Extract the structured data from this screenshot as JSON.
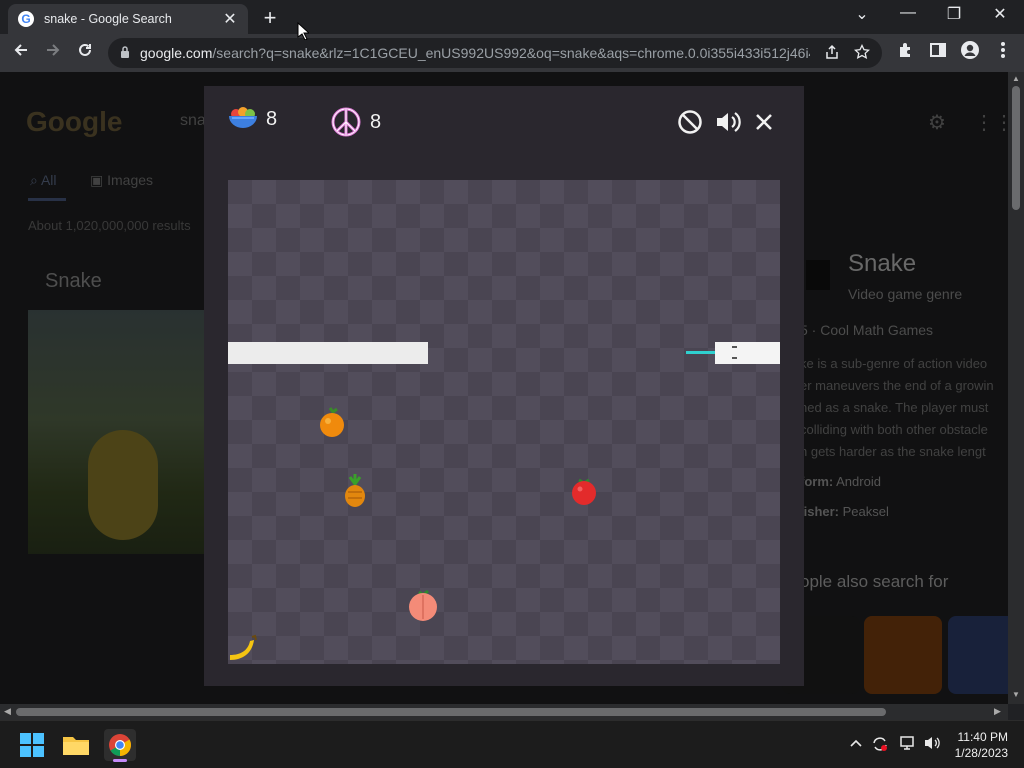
{
  "browser": {
    "tab_title": "snake - Google Search",
    "tab_close_glyph": "✕",
    "new_tab_glyph": "+",
    "url_host": "google.com",
    "url_rest": "/search?q=snake&rlz=1C1GCEU_enUS992US992&oq=snake&aqs=chrome.0.0i355i433i512j46i4...",
    "window_controls": [
      "⌄",
      "—",
      "❐",
      "✕"
    ]
  },
  "page": {
    "logo": "Google",
    "search_query": "snake",
    "tabs": [
      "All",
      "Images"
    ],
    "results_count": "About 1,020,000,000 results",
    "heading": "Snake",
    "knowledge_panel": {
      "title": "Snake",
      "subtitle": "Video game genre",
      "source": "5 · Cool Math Games",
      "lines": [
        "ke is a sub-genre of action video",
        "er maneuvers the end of a growin",
        "ned as a snake. The player must",
        "colliding with both other obstacle",
        "h gets harder as the snake lengt"
      ],
      "platform_label": "form:",
      "platform_value": "Android",
      "publisher_label": "lisher:",
      "publisher_value": "Peaksel",
      "people_also_search": "ople also search for"
    }
  },
  "game": {
    "fruit_score": "8",
    "peace_score": "8",
    "icons": {
      "fruit_score": "fruit-bowl-icon",
      "peace_score": "peace-icon",
      "block": "block-icon",
      "sound": "speaker-icon",
      "close": "close-icon"
    },
    "colors": {
      "board_light": "#4a4552",
      "board_dark": "#524d5b",
      "wall": "#ececec",
      "snake_tongue": "#2fd0cf"
    }
  },
  "taskbar": {
    "time": "11:40 PM",
    "date": "1/28/2023"
  }
}
